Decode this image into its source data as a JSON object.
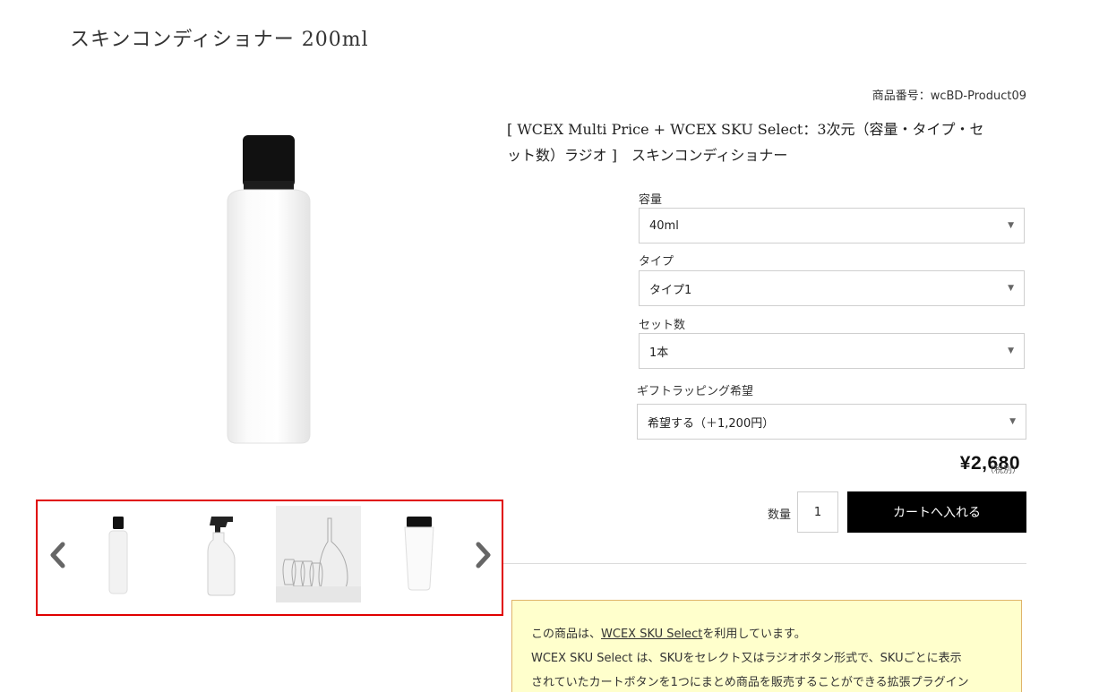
{
  "page": {
    "title": "スキンコンディショナー 200ml"
  },
  "product": {
    "sku_code": "商品番号：wcBD-Product09",
    "name_line1": "[ WCEX Multi Price + WCEX SKU Select：3次元（容量・タイプ・セ",
    "name_line2": "ット数）ラジオ ]　スキンコンディショナー",
    "main_image_icon": "white-bottle-image"
  },
  "gallery": {
    "prev_icon": "chevron-left-icon",
    "next_icon": "chevron-right-icon",
    "thumbnails": [
      {
        "icon": "bottle-thumbnail"
      },
      {
        "icon": "spray-bottle-thumbnail"
      },
      {
        "icon": "glass-bottles-thumbnail"
      },
      {
        "icon": "cream-bottle-thumbnail"
      }
    ]
  },
  "options": [
    {
      "label": "容量",
      "value": "40ml"
    },
    {
      "label": "タイプ",
      "value": "タイプ1"
    },
    {
      "label": "セット数",
      "value": "1本"
    },
    {
      "label": "ギフトラッピング希望",
      "value": "希望する（＋1,200円）"
    }
  ],
  "price": {
    "amount": "¥2,680",
    "tax_note": "（税別）"
  },
  "cart": {
    "qty_label": "数量",
    "qty_value": "1",
    "button_label": "カートへ入れる"
  },
  "notice": {
    "line1_prefix": "この商品は、",
    "line1_link": "WCEX SKU Select",
    "line1_suffix": "を利用しています。",
    "line2": "WCEX SKU Select は、SKUをセレクト又はラジオボタン形式で、SKUごとに表示",
    "line3": "されていたカートボタンを1つにまとめ商品を販売することができる拡張プラグイン"
  },
  "colors": {
    "highlight_border": "#e00000",
    "notice_bg": "#ffffcc",
    "button_bg": "#000000"
  }
}
